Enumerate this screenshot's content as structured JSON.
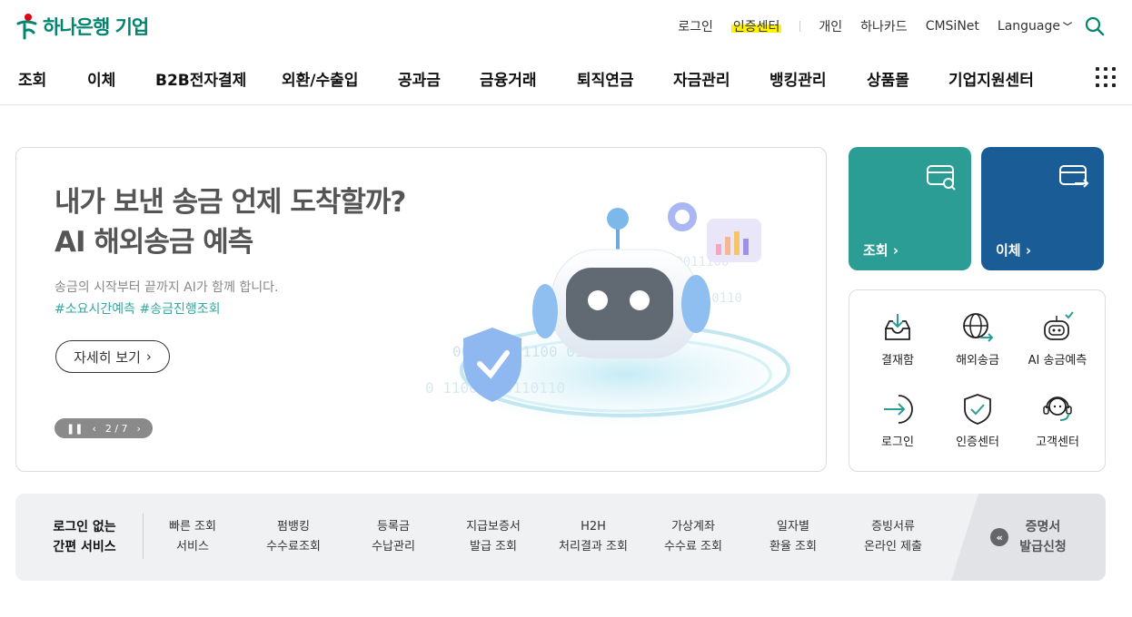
{
  "header": {
    "logo_text": "하나은행 기업",
    "util": {
      "login": "로그인",
      "cert_center": "인증센터",
      "personal": "개인",
      "hanacard": "하나카드",
      "cmsinet": "CMSiNet",
      "language": "Language"
    },
    "gnb": [
      "조회",
      "이체",
      "B2B전자결제",
      "외환/수출입",
      "공과금",
      "금융거래",
      "퇴직연금",
      "자금관리",
      "뱅킹관리",
      "상품몰",
      "기업지원센터"
    ]
  },
  "banner": {
    "title_line1": "내가 보낸 송금 언제 도착할까?",
    "title_line2": "AI 해외송금 예측",
    "desc": "송금의 시작부터 끝까지 AI가 함께 합니다.",
    "tags": "#소요시간예측 #송금진행조회",
    "detail_label": "자세히 보기",
    "pager": {
      "current": "2",
      "total": "7"
    }
  },
  "tiles": {
    "inquiry_label": "조회",
    "transfer_label": "이체",
    "inquiry_color": "#2b9d95",
    "transfer_color": "#1a5d96"
  },
  "quick_menu": [
    {
      "label": "결재함",
      "icon": "inbox-download-icon"
    },
    {
      "label": "해외송금",
      "icon": "globe-transfer-icon"
    },
    {
      "label": "AI 송금예측",
      "icon": "robot-icon"
    },
    {
      "label": "로그인",
      "icon": "login-arrow-icon"
    },
    {
      "label": "인증센터",
      "icon": "shield-check-icon"
    },
    {
      "label": "고객센터",
      "icon": "headset-icon"
    }
  ],
  "service_bar": {
    "title_line1": "로그인 없는",
    "title_line2": "간편 서비스",
    "items": [
      {
        "line1": "빠른 조회",
        "line2": "서비스"
      },
      {
        "line1": "펌뱅킹",
        "line2": "수수료조회"
      },
      {
        "line1": "등록금",
        "line2": "수납관리"
      },
      {
        "line1": "지급보증서",
        "line2": "발급 조회"
      },
      {
        "line1": "H2H",
        "line2": "처리결과 조회"
      },
      {
        "line1": "가상계좌",
        "line2": "수수료 조회"
      },
      {
        "line1": "일자별",
        "line2": "환율 조회"
      },
      {
        "line1": "증빙서류",
        "line2": "온라인 제출"
      }
    ],
    "cert_line1": "증명서",
    "cert_line2": "발급신청"
  }
}
